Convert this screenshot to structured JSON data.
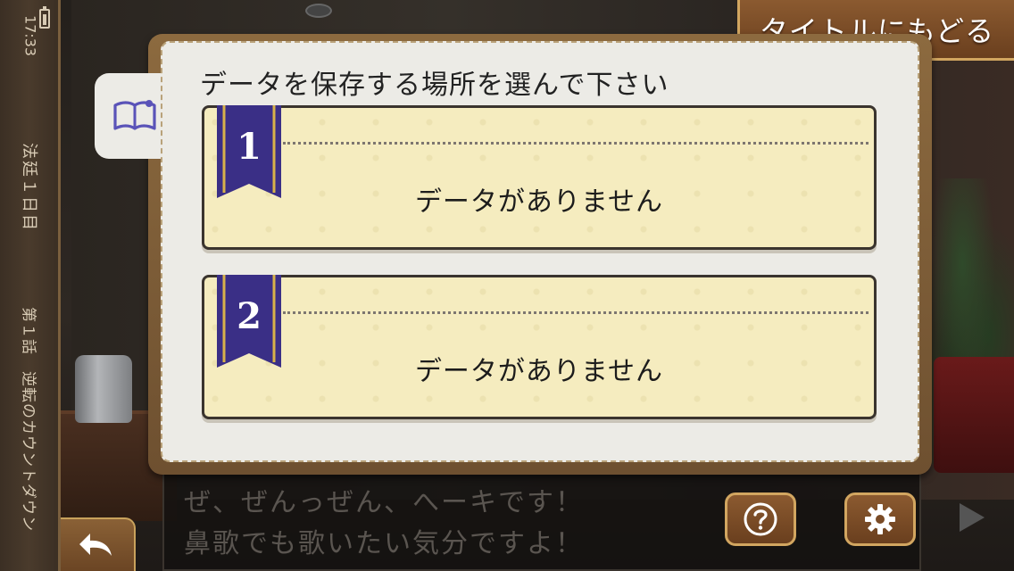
{
  "status": {
    "time": "17:33",
    "day": "法廷１日目",
    "chapter": "第１話　逆転のカウントダウン"
  },
  "header": {
    "title_button": "タイトルにもどる"
  },
  "save_panel": {
    "heading": "データを保存する場所を選んで下さい",
    "slots": [
      {
        "number": "1",
        "status": "データがありません"
      },
      {
        "number": "2",
        "status": "データがありません"
      }
    ]
  },
  "dialogue": {
    "line1": "ぜ、ぜんっぜん、へーキです！",
    "line2": "鼻歌でも歌いたい気分ですよ！"
  },
  "controls": {
    "help_icon": "question-mark-icon",
    "settings_icon": "gear-icon",
    "back_icon": "undo-arrow-icon",
    "next_icon": "play-arrow-icon"
  },
  "colors": {
    "ribbon": "#3a2f86",
    "ribbon_stripe": "#d7b24a",
    "brown_button": "#7a4b26",
    "gold_border": "#d2a660",
    "slot_bg": "#f5ecbf"
  }
}
